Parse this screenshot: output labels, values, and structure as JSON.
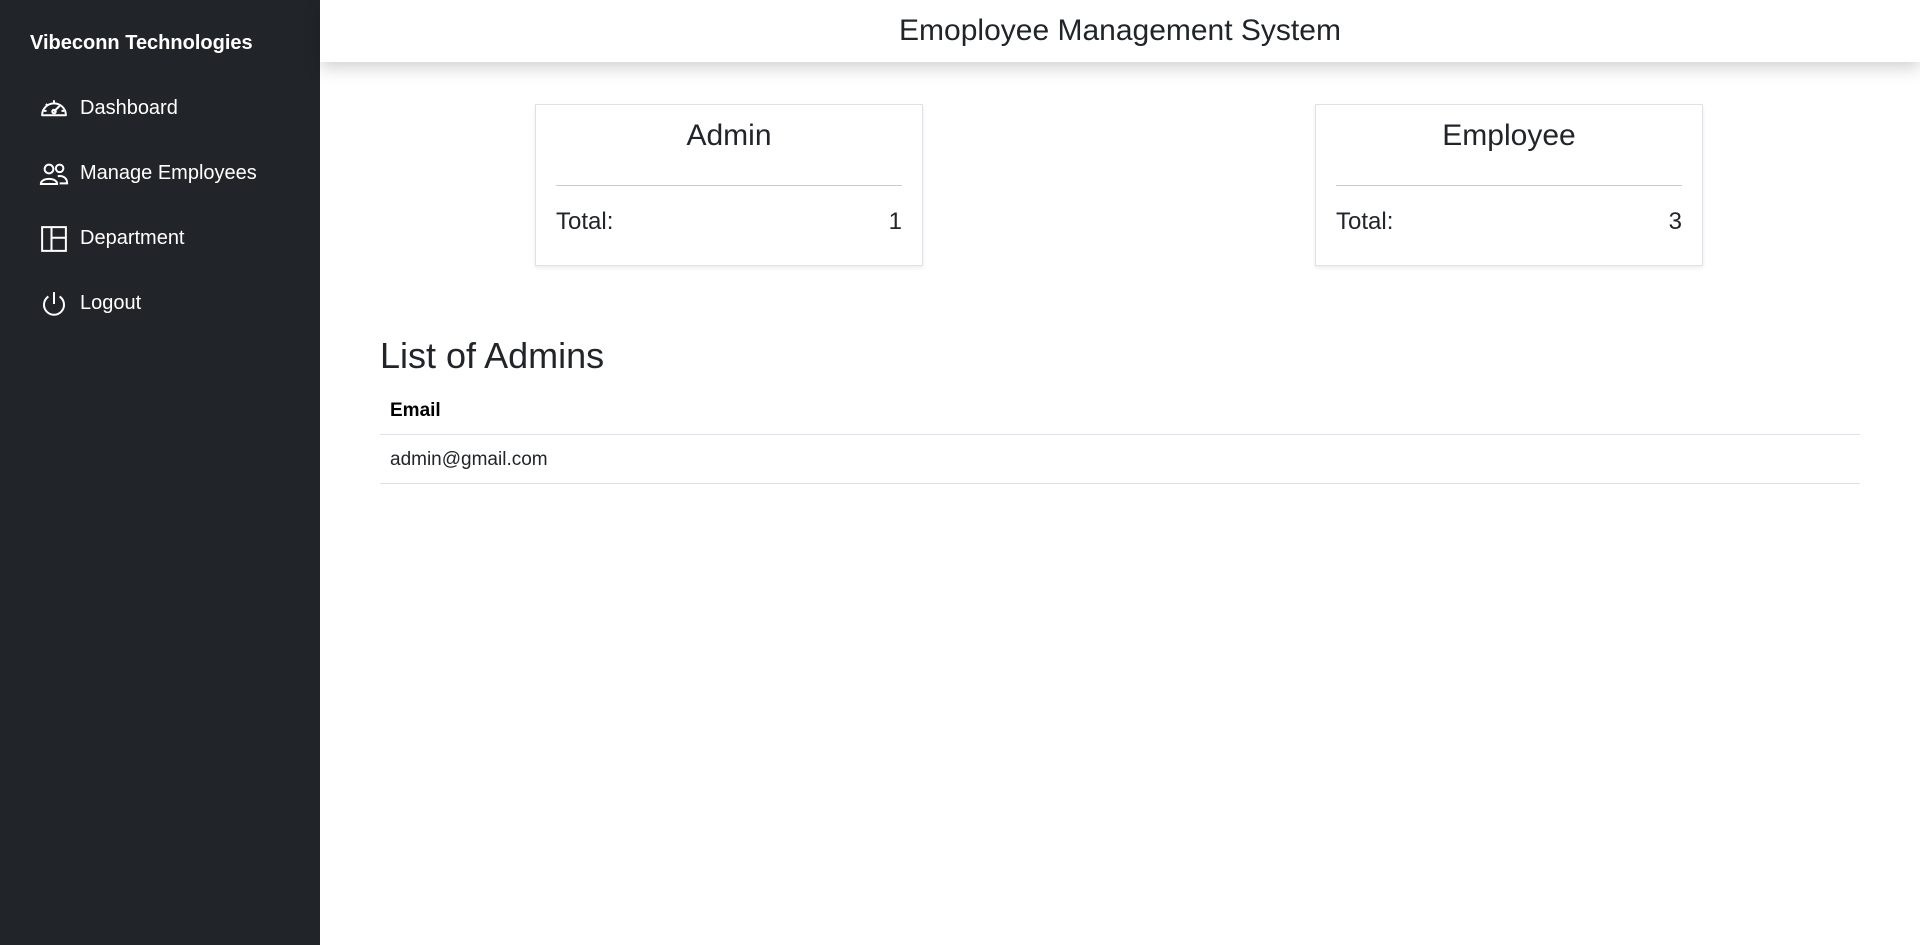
{
  "sidebar": {
    "brand": "Vibeconn Technologies",
    "items": [
      {
        "label": "Dashboard",
        "icon": "speedometer-icon"
      },
      {
        "label": "Manage Employees",
        "icon": "people-icon"
      },
      {
        "label": "Department",
        "icon": "layout-icon"
      },
      {
        "label": "Logout",
        "icon": "power-icon"
      }
    ]
  },
  "header": {
    "title": "Emoployee Management System"
  },
  "cards": {
    "admin": {
      "title": "Admin",
      "total_label": "Total:",
      "total_value": "1"
    },
    "employee": {
      "title": "Employee",
      "total_label": "Total:",
      "total_value": "3"
    }
  },
  "admins": {
    "title": "List of Admins",
    "columns": [
      "Email"
    ],
    "rows": [
      [
        "admin@gmail.com"
      ]
    ]
  },
  "colors": {
    "sidebar_bg": "#212529",
    "text": "#212529"
  }
}
